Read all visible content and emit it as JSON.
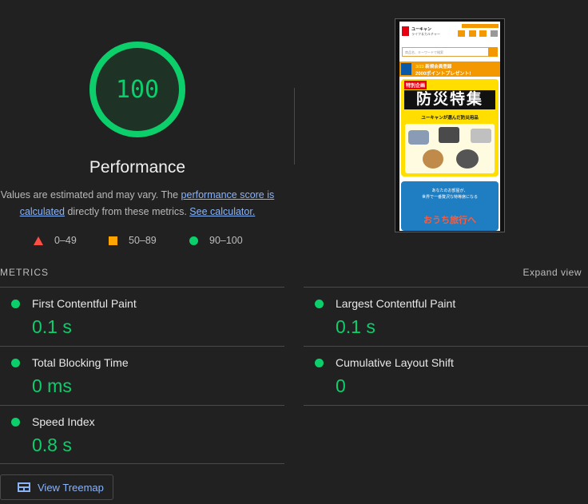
{
  "score": {
    "value": "100",
    "title": "Performance",
    "note_prefix": "Values are estimated and may vary. The ",
    "note_link1": "performance score is calculated",
    "note_middle": " directly from these metrics. ",
    "note_link2": "See calculator.",
    "color": "#0cce6b"
  },
  "legend": [
    {
      "shape": "triangle",
      "label": "0–49",
      "color": "#ff4e42"
    },
    {
      "shape": "square",
      "label": "50–89",
      "color": "#ffa400"
    },
    {
      "shape": "circle",
      "label": "90–100",
      "color": "#0cce6b"
    }
  ],
  "thumbnail": {
    "brand": "ユーキャン",
    "brand_sub": "ライフ＆カルチャー",
    "search_placeholder": "商品名、キーワードで検索",
    "banner_date": "3/23",
    "banner_text": "新規会員登録",
    "banner_points": "2000ポイントプレゼント!",
    "badge": "特別企画",
    "promo_title": "防災特集",
    "promo_sub": "ユーキャンが選んだ防災用品",
    "travel_line1": "あなたのお部屋が、",
    "travel_line2": "世界で一番贅沢な特等席になる",
    "travel_title": "おうち旅行へ"
  },
  "metrics_header": {
    "title": "METRICS",
    "expand": "Expand view"
  },
  "metrics": [
    {
      "name": "First Contentful Paint",
      "value": "0.1 s"
    },
    {
      "name": "Largest Contentful Paint",
      "value": "0.1 s"
    },
    {
      "name": "Total Blocking Time",
      "value": "0 ms"
    },
    {
      "name": "Cumulative Layout Shift",
      "value": "0"
    },
    {
      "name": "Speed Index",
      "value": "0.8 s"
    }
  ],
  "treemap_button": "View Treemap"
}
